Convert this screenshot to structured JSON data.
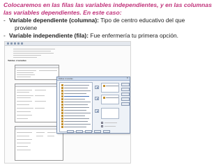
{
  "slide": {
    "intro_line1": "Colocaremos en las filas las variables independientes, y en las columnas",
    "intro_line2": "las variables dependientes. En este caso:",
    "bullets": [
      {
        "term": "Variable dependiente (columna):",
        "text": " Tipo de centro educativo del que",
        "cont": "proviene"
      },
      {
        "term": "Variable independiente (fila):",
        "text": " Fue enfermería tu primera opción.",
        "cont": ""
      }
    ]
  },
  "screenshot": {
    "section_label": "Tablas cruzadas",
    "dialog_title": "Tablas cruzadas"
  }
}
